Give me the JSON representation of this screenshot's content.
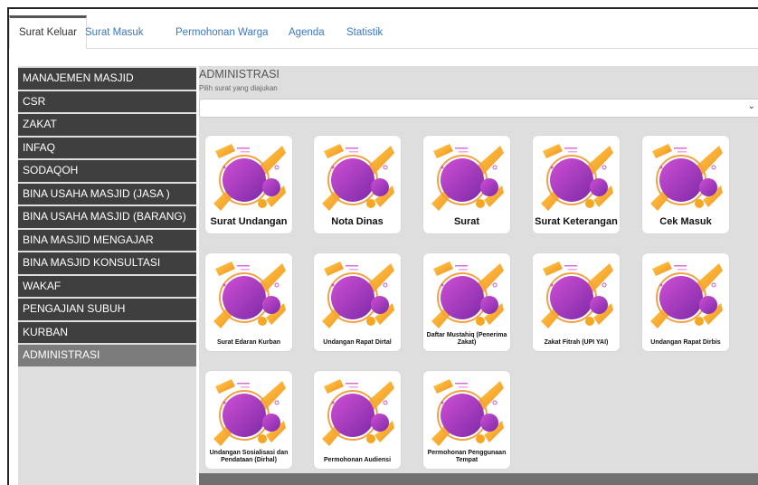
{
  "tabs": [
    {
      "label": "Surat Keluar",
      "active": true
    },
    {
      "label": "Surat Masuk",
      "active": false
    },
    {
      "label": "Permohonan Warga",
      "active": false
    },
    {
      "label": "Agenda",
      "active": false
    },
    {
      "label": "Statistik",
      "active": false
    }
  ],
  "sidebar": {
    "items": [
      {
        "label": "MANAJEMEN MASJID"
      },
      {
        "label": "CSR"
      },
      {
        "label": "ZAKAT"
      },
      {
        "label": "INFAQ"
      },
      {
        "label": "SODAQOH"
      },
      {
        "label": "BINA USAHA MASJID (JASA )"
      },
      {
        "label": "BINA USAHA MASJID (BARANG)"
      },
      {
        "label": "BINA MASJID MENGAJAR"
      },
      {
        "label": "BINA MASJID KONSULTASI"
      },
      {
        "label": "WAKAF"
      },
      {
        "label": "PENGAJIAN SUBUH"
      },
      {
        "label": "KURBAN"
      },
      {
        "label": "ADMINISTRASI",
        "active": true
      }
    ]
  },
  "main": {
    "title": "ADMINISTRASI",
    "subtitle": "Pilih surat yang diajukan",
    "select_value": "",
    "cards": [
      {
        "label": "Surat Undangan"
      },
      {
        "label": "Nota Dinas"
      },
      {
        "label": "Surat"
      },
      {
        "label": "Surat Keterangan"
      },
      {
        "label": "Cek Masuk"
      },
      {
        "label": "Surat Edaran Kurban"
      },
      {
        "label": "Undangan Rapat Dirtal"
      },
      {
        "label": "Daftar Mustahiq (Penerima Zakat)"
      },
      {
        "label": "Zakat Fitrah (UPI YAI)"
      },
      {
        "label": "Undangan Rapat Dirbis"
      },
      {
        "label": "Undangan Sosialisasi dan Pendataan (Dirhal)"
      },
      {
        "label": "Permohonan Audiensi"
      },
      {
        "label": "Permohonan Penggunaan Tempat"
      }
    ]
  },
  "colors": {
    "tab_link": "#3a78c3",
    "sidebar_bg": "#3f3f3f",
    "sidebar_active": "#7c7c7c",
    "panel_bg": "#dedede",
    "art_purple": "#a23bb8",
    "art_orange": "#f5a623"
  }
}
